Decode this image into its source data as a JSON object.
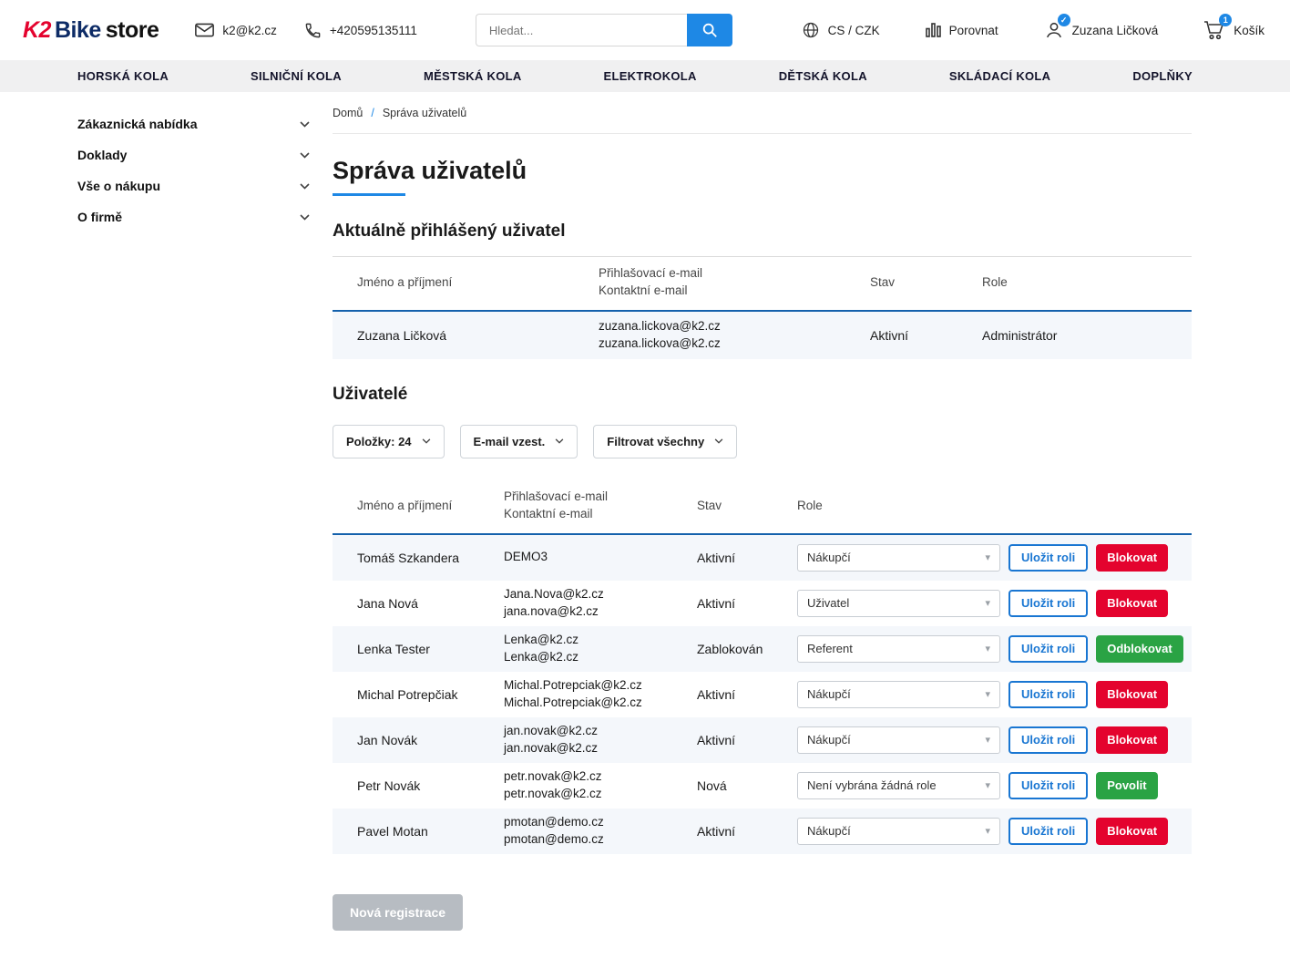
{
  "header": {
    "logo": {
      "k2": "K2",
      "bike": "Bike",
      "store": "store"
    },
    "email": "k2@k2.cz",
    "phone": "+420595135111",
    "search": {
      "placeholder": "Hledat..."
    },
    "locale": "CS / CZK",
    "compare": "Porovnat",
    "user_name": "Zuzana Ličková",
    "cart_label": "Košík",
    "cart_count": "1"
  },
  "nav": {
    "items": [
      "HORSKÁ KOLA",
      "SILNIČNÍ KOLA",
      "MĚSTSKÁ KOLA",
      "ELEKTROKOLA",
      "DĚTSKÁ KOLA",
      "SKLÁDACÍ KOLA",
      "DOPLŇKY"
    ]
  },
  "sidebar": {
    "items": [
      "Zákaznická nabídka",
      "Doklady",
      "Vše o nákupu",
      "O firmě"
    ]
  },
  "breadcrumb": {
    "home": "Domů",
    "separator": "/",
    "current": "Správa uživatelů"
  },
  "page_title": "Správa uživatelů",
  "columns": {
    "name": "Jméno a příjmení",
    "login_email": "Přihlašovací e-mail",
    "contact_email": "Kontaktní e-mail",
    "status": "Stav",
    "role": "Role"
  },
  "current_user": {
    "heading": "Aktuálně přihlášený uživatel",
    "row": {
      "name": "Zuzana Ličková",
      "login_email": "zuzana.lickova@k2.cz",
      "contact_email": "zuzana.lickova@k2.cz",
      "status": "Aktivní",
      "role": "Administrátor"
    }
  },
  "users": {
    "heading": "Uživatelé",
    "controls": {
      "page_size": "Položky: 24",
      "sort": "E-mail vzest.",
      "filter": "Filtrovat všechny"
    },
    "save_role_label": "Uložit roli",
    "new_registration": "Nová registrace",
    "rows": [
      {
        "name": "Tomáš Szkandera",
        "login_email": "DEMO3",
        "contact_email": "",
        "status": "Aktivní",
        "role": "Nákupčí",
        "action": "Blokovat",
        "action_type": "block"
      },
      {
        "name": "Jana Nová",
        "login_email": "Jana.Nova@k2.cz",
        "contact_email": "jana.nova@k2.cz",
        "status": "Aktivní",
        "role": "Uživatel",
        "action": "Blokovat",
        "action_type": "block"
      },
      {
        "name": "Lenka Tester",
        "login_email": "Lenka@k2.cz",
        "contact_email": "Lenka@k2.cz",
        "status": "Zablokován",
        "role": "Referent",
        "action": "Odblokovat",
        "action_type": "unblock"
      },
      {
        "name": "Michal Potrepčiak",
        "login_email": "Michal.Potrepciak@k2.cz",
        "contact_email": "Michal.Potrepciak@k2.cz",
        "status": "Aktivní",
        "role": "Nákupčí",
        "action": "Blokovat",
        "action_type": "block"
      },
      {
        "name": "Jan Novák",
        "login_email": "jan.novak@k2.cz",
        "contact_email": "jan.novak@k2.cz",
        "status": "Aktivní",
        "role": "Nákupčí",
        "action": "Blokovat",
        "action_type": "block"
      },
      {
        "name": "Petr Novák",
        "login_email": "petr.novak@k2.cz",
        "contact_email": "petr.novak@k2.cz",
        "status": "Nová",
        "role": "Není vybrána žádná role",
        "action": "Povolit",
        "action_type": "allow"
      },
      {
        "name": "Pavel Motan",
        "login_email": "pmotan@demo.cz",
        "contact_email": "pmotan@demo.cz",
        "status": "Aktivní",
        "role": "Nákupčí",
        "action": "Blokovat",
        "action_type": "block"
      }
    ]
  },
  "glyphs": {
    "caret": "▾",
    "check": "✓"
  },
  "colors": {
    "accent_blue": "#1e88e5",
    "button_blue": "#1976d2",
    "danger_red": "#e4032e",
    "success_green": "#2aa344",
    "table_header_border": "#1461ac",
    "row_stripe": "#f4f7fb",
    "nav_bg": "#f0f0f1"
  }
}
